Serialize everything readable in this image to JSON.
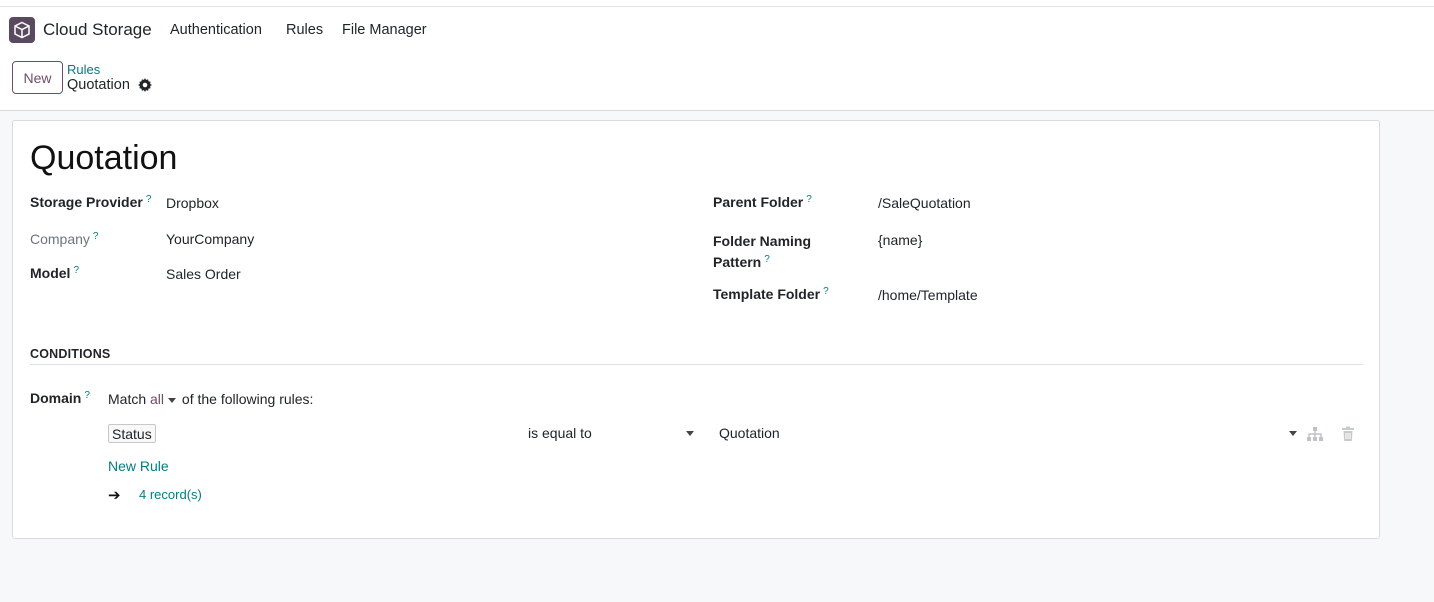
{
  "app": {
    "name": "Cloud Storage",
    "nav": [
      "Authentication",
      "Rules",
      "File Manager"
    ]
  },
  "control": {
    "new_label": "New",
    "breadcrumb_parent": "Rules",
    "breadcrumb_current": "Quotation"
  },
  "form": {
    "title": "Quotation",
    "left": [
      {
        "label": "Storage Provider",
        "value": "Dropbox"
      },
      {
        "label": "Company",
        "value": "YourCompany"
      },
      {
        "label": "Model",
        "value": "Sales Order"
      }
    ],
    "right": [
      {
        "label": "Parent Folder",
        "value": "/SaleQuotation"
      },
      {
        "label_line1": "Folder Naming",
        "label_line2": "Pattern",
        "value": "{name}"
      },
      {
        "label": "Template Folder",
        "value": "/home/Template"
      }
    ],
    "help_mark": "?"
  },
  "conditions": {
    "section_title": "CONDITIONS",
    "domain_label": "Domain",
    "match_prefix": "Match",
    "match_value": "all",
    "match_suffix": "of the following rules:",
    "rule": {
      "field": "Status",
      "operator": "is equal to",
      "value": "Quotation"
    },
    "new_rule_label": "New Rule",
    "arrow": "➔",
    "records_label": "4 record(s)"
  },
  "colors": {
    "brand": "#714b67",
    "link": "#017e84"
  }
}
